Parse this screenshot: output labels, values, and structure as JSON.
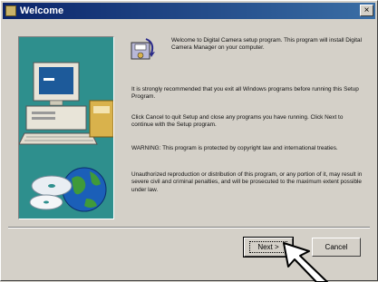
{
  "window": {
    "title": "Welcome",
    "close_glyph": "×"
  },
  "content": {
    "intro": "Welcome to Digital Camera setup program. This program will install Digital Camera Manager on your computer.",
    "paragraphs": [
      "It is strongly recommended that you exit all Windows programs before running this Setup Program.",
      "Click Cancel to quit Setup and close any programs you have running. Click Next to continue with the Setup program.",
      "WARNING: This program is protected by copyright law and international treaties.",
      "Unauthorized reproduction or distribution of this program, or any portion of it, may result in severe civil and criminal penalties, and will be prosecuted to the maximum extent possible under law."
    ]
  },
  "buttons": {
    "next": "Next >",
    "cancel": "Cancel"
  },
  "colors": {
    "panel": "#2e8f8d",
    "titlebar_start": "#0a246a",
    "titlebar_end": "#3a6ea5"
  },
  "icons": {
    "title": "setup-app-icon",
    "setup": "installer-disk-icon",
    "panel": "computer-globe-illustration",
    "pointer": "annotation-arrow"
  }
}
